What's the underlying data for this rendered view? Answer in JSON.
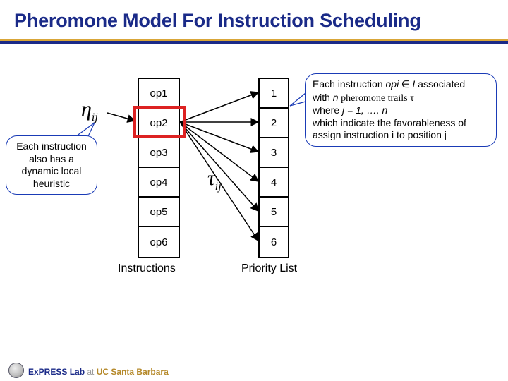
{
  "title": "Pheromone Model For Instruction Scheduling",
  "symbols": {
    "eta": "η",
    "eta_sub": "ij",
    "tau": "τ",
    "tau_sub": "ij"
  },
  "instructions_col": {
    "label": "Instructions",
    "items": [
      "op1",
      "op2",
      "op3",
      "op4",
      "op5",
      "op6"
    ]
  },
  "priority_col": {
    "label": "Priority List",
    "items": [
      "1",
      "2",
      "3",
      "4",
      "5",
      "6"
    ]
  },
  "highlight_op_index": 1,
  "callouts": {
    "left": "Each instruction also has a dynamic local heuristic",
    "right_line1_a": "Each instruction ",
    "right_line1_b": "opi",
    "right_line1_c": " ∈ ",
    "right_line1_d": "I",
    "right_line1_e": " associated",
    "right_line2_a": "with ",
    "right_line2_b": "n",
    "right_line2_c": " pheromone trails τ",
    "right_line3_a": "where ",
    "right_line3_b": "j = 1, …, n",
    "right_line4": "which indicate the favorableness of assign instruction i to position j"
  },
  "footer": {
    "lab": "ExPRESS Lab",
    "at": " at ",
    "ucsb": "UC Santa Barbara"
  }
}
